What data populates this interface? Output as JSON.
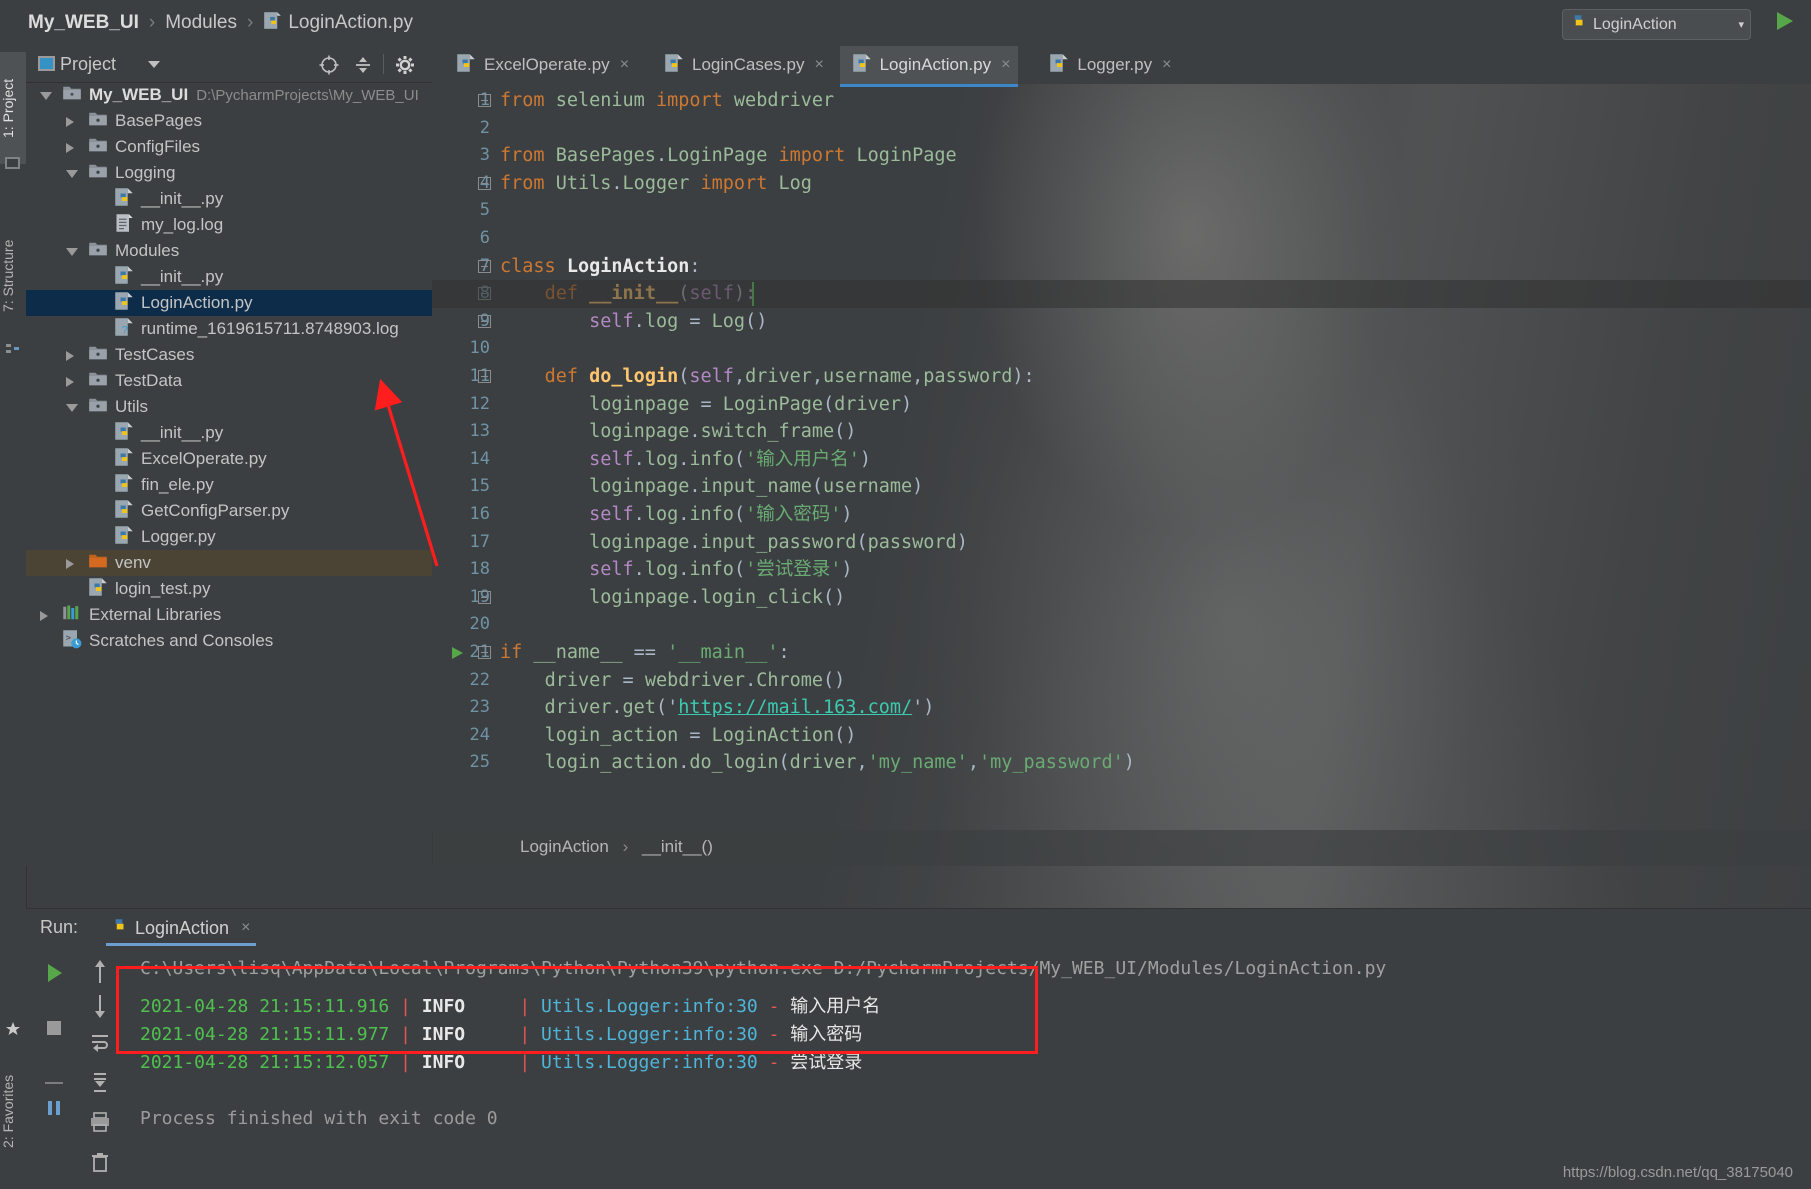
{
  "titlebar": {
    "crumbs": [
      {
        "label": "My_WEB_UI",
        "strong": true,
        "icon": ""
      },
      {
        "label": "Modules",
        "strong": false,
        "icon": ""
      },
      {
        "label": "LoginAction.py",
        "strong": false,
        "icon": "python-file-icon"
      }
    ],
    "separator": "›",
    "run_config": "LoginAction",
    "run_config_caret": "▾",
    "run_button": "run-button"
  },
  "left_strip": {
    "project_tab": "1: Project",
    "structure_tab": "7: Structure",
    "favorites_tab": "2: Favorites"
  },
  "project_panel": {
    "title": "Project",
    "caret": "▾",
    "icons": [
      "locate-icon",
      "collapse-all-icon",
      "gear-icon",
      "hide-icon"
    ],
    "tree": [
      {
        "depth": 0,
        "arrow": "down",
        "icon": "folder-icon",
        "label": "My_WEB_UI",
        "bold": true,
        "path": "D:\\PycharmProjects\\My_WEB_UI"
      },
      {
        "depth": 1,
        "arrow": "right",
        "icon": "folder-module-icon",
        "label": "BasePages"
      },
      {
        "depth": 1,
        "arrow": "right",
        "icon": "folder-module-icon",
        "label": "ConfigFiles"
      },
      {
        "depth": 1,
        "arrow": "down",
        "icon": "folder-module-icon",
        "label": "Logging"
      },
      {
        "depth": 2,
        "arrow": "none",
        "icon": "python-file-icon",
        "label": "__init__.py"
      },
      {
        "depth": 2,
        "arrow": "none",
        "icon": "log-file-icon",
        "label": "my_log.log"
      },
      {
        "depth": 1,
        "arrow": "down",
        "icon": "folder-module-icon",
        "label": "Modules"
      },
      {
        "depth": 2,
        "arrow": "none",
        "icon": "python-file-icon",
        "label": "__init__.py"
      },
      {
        "depth": 2,
        "arrow": "none",
        "icon": "python-file-icon",
        "label": "LoginAction.py",
        "selected": true
      },
      {
        "depth": 2,
        "arrow": "none",
        "icon": "unknown-file-icon",
        "label": "runtime_1619615711.8748903.log"
      },
      {
        "depth": 1,
        "arrow": "right",
        "icon": "folder-module-icon",
        "label": "TestCases"
      },
      {
        "depth": 1,
        "arrow": "right",
        "icon": "folder-module-icon",
        "label": "TestData"
      },
      {
        "depth": 1,
        "arrow": "down",
        "icon": "folder-module-icon",
        "label": "Utils"
      },
      {
        "depth": 2,
        "arrow": "none",
        "icon": "python-file-icon",
        "label": "__init__.py"
      },
      {
        "depth": 2,
        "arrow": "none",
        "icon": "python-file-icon",
        "label": "ExcelOperate.py"
      },
      {
        "depth": 2,
        "arrow": "none",
        "icon": "python-file-icon",
        "label": "fin_ele.py"
      },
      {
        "depth": 2,
        "arrow": "none",
        "icon": "python-file-icon",
        "label": "GetConfigParser.py"
      },
      {
        "depth": 2,
        "arrow": "none",
        "icon": "python-file-icon",
        "label": "Logger.py"
      },
      {
        "depth": 1,
        "arrow": "right",
        "icon": "folder-venv-icon",
        "label": "venv",
        "highlight": true
      },
      {
        "depth": 1,
        "arrow": "none",
        "icon": "python-file-icon",
        "label": "login_test.py"
      },
      {
        "depth": 0,
        "arrow": "right",
        "icon": "libraries-icon",
        "label": "External Libraries"
      },
      {
        "depth": 0,
        "arrow": "none",
        "icon": "scratches-icon",
        "label": "Scratches and Consoles"
      }
    ]
  },
  "editor": {
    "tabs": [
      {
        "label": "ExcelOperate.py",
        "icon": "python-file-icon",
        "close": "×",
        "active": false
      },
      {
        "label": "LoginCases.py",
        "icon": "python-file-icon",
        "close": "×",
        "active": false
      },
      {
        "label": "LoginAction.py",
        "icon": "python-file-icon",
        "close": "×",
        "active": true
      },
      {
        "label": "Logger.py",
        "icon": "python-file-icon",
        "close": "×",
        "active": false
      }
    ],
    "line_numbers": [
      "1",
      "2",
      "3",
      "4",
      "5",
      "6",
      "7",
      "8",
      "9",
      "10",
      "11",
      "12",
      "13",
      "14",
      "15",
      "16",
      "17",
      "18",
      "19",
      "20",
      "21",
      "22",
      "23",
      "24",
      "25"
    ],
    "lines": [
      "from selenium import webdriver",
      "",
      "from BasePages.LoginPage import LoginPage",
      "from Utils.Logger import Log",
      "",
      "",
      "class LoginAction:",
      "    def __init__(self):",
      "        self.log = Log()",
      "",
      "    def do_login(self,driver,username,password):",
      "        loginpage = LoginPage(driver)",
      "        loginpage.switch_frame()",
      "        self.log.info('输入用户名')",
      "        loginpage.input_name(username)",
      "        self.log.info('输入密码')",
      "        loginpage.input_password(password)",
      "        self.log.info('尝试登录')",
      "        loginpage.login_click()",
      "",
      "if __name__ == '__main__':",
      "    driver = webdriver.Chrome()",
      "    driver.get('https://mail.163.com/')",
      "    login_action = LoginAction()",
      "    login_action.do_login(driver,'my_name','my_password')"
    ],
    "caret_line": 8,
    "breadcrumb": [
      "LoginAction",
      "__init__()"
    ],
    "breadcrumb_sep": "›"
  },
  "run_panel": {
    "label": "Run:",
    "tab": "LoginAction",
    "tab_icon": "python-file-icon",
    "tab_close": "×",
    "gutter_icons": [
      "run-icon",
      "stop-icon",
      "rerun-icon",
      "pin-icon",
      "up-arrow-icon",
      "down-arrow-icon",
      "soft-wrap-icon",
      "scroll-to-end-icon",
      "print-icon",
      "trash-icon"
    ],
    "command_line": "C:\\Users\\lisq\\AppData\\Local\\Programs\\Python\\Python39\\python.exe D:/PycharmProjects/My_WEB_UI/Modules/LoginAction.py",
    "log_rows": [
      {
        "ts": "2021-04-28 21:15:11.916",
        "level": "INFO",
        "logger": "Utils.Logger:info:30",
        "dash": "-",
        "msg": "输入用户名"
      },
      {
        "ts": "2021-04-28 21:15:11.977",
        "level": "INFO",
        "logger": "Utils.Logger:info:30",
        "dash": "-",
        "msg": "输入密码"
      },
      {
        "ts": "2021-04-28 21:15:12.057",
        "level": "INFO",
        "logger": "Utils.Logger:info:30",
        "dash": "-",
        "msg": "尝试登录"
      }
    ],
    "pipe": "|",
    "finished": "Process finished with exit code 0"
  },
  "annotations": {
    "arrow_color": "#ff1d1d",
    "box_color": "#ff1d1d",
    "arrow_target": "runtime_1619615711.8748903.log",
    "box_target": "log-rows"
  },
  "watermark": "https://blog.csdn.net/qq_38175040",
  "colors": {
    "accent": "#3d87c9",
    "selection": "#0d2c4a",
    "background": "#3c3f41",
    "keyword": "#cc7832",
    "string": "#6aab73",
    "function": "#ffc66d",
    "console_green": "#4fc04f",
    "console_red": "#e05555",
    "console_cyan": "#4fb5d8"
  }
}
